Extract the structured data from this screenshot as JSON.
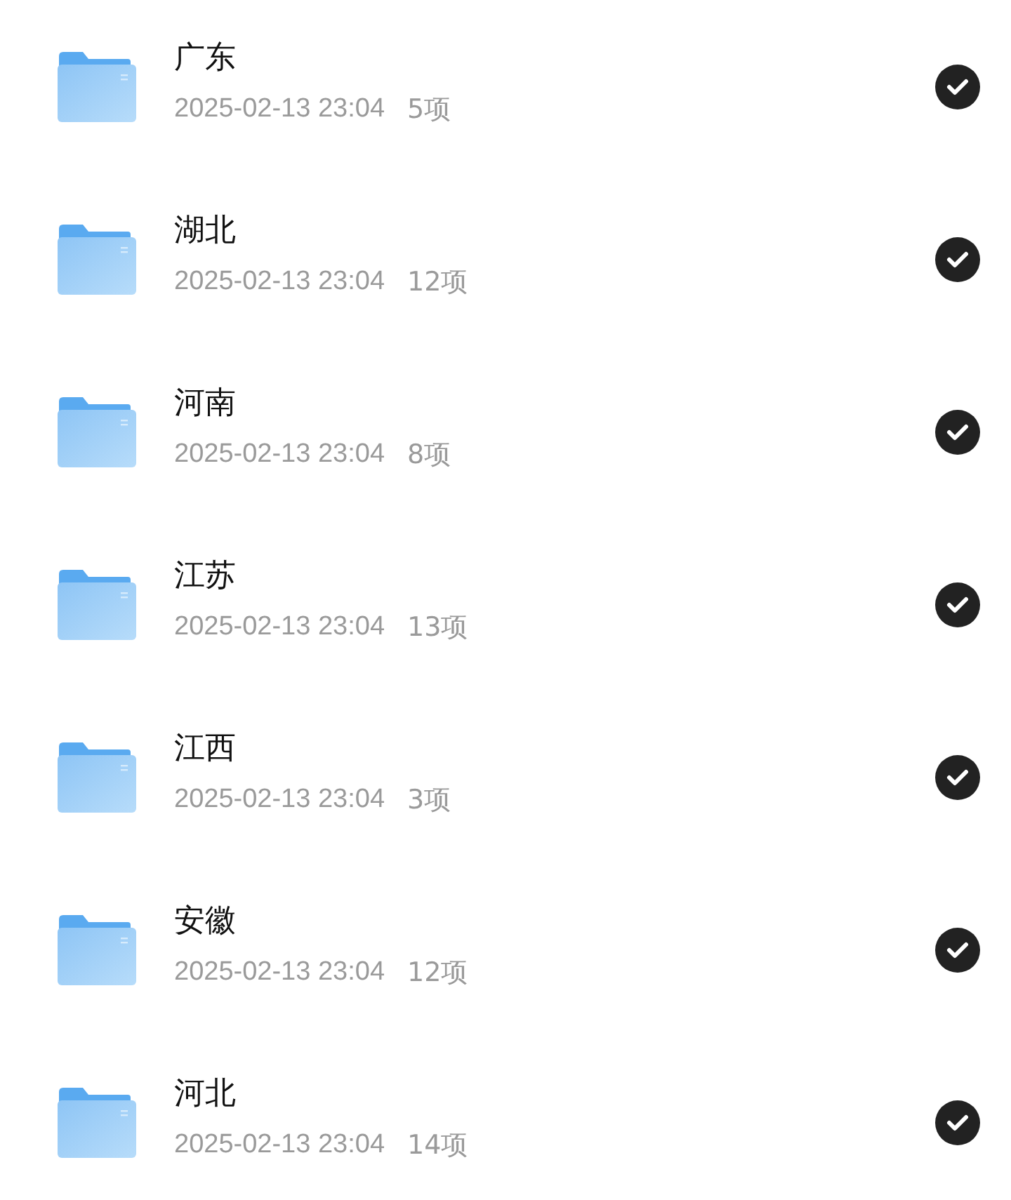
{
  "folders": [
    {
      "name": "广东",
      "date": "2025-02-13 23:04",
      "count": "5项",
      "selected": true
    },
    {
      "name": "湖北",
      "date": "2025-02-13 23:04",
      "count": "12项",
      "selected": true
    },
    {
      "name": "河南",
      "date": "2025-02-13 23:04",
      "count": "8项",
      "selected": true
    },
    {
      "name": "江苏",
      "date": "2025-02-13 23:04",
      "count": "13项",
      "selected": true
    },
    {
      "name": "江西",
      "date": "2025-02-13 23:04",
      "count": "3项",
      "selected": true
    },
    {
      "name": "安徽",
      "date": "2025-02-13 23:04",
      "count": "12项",
      "selected": true
    },
    {
      "name": "河北",
      "date": "2025-02-13 23:04",
      "count": "14项",
      "selected": true
    }
  ]
}
